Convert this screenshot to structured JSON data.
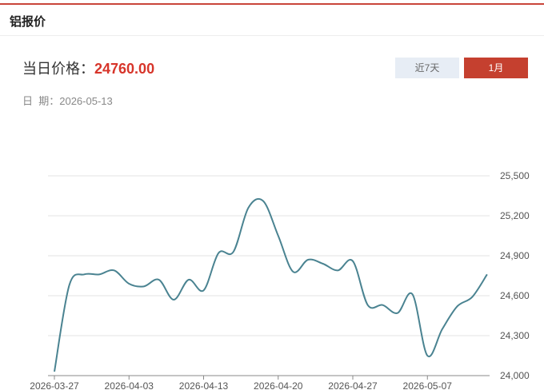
{
  "header": {
    "title": "铝报价"
  },
  "summary": {
    "price_label": "当日价格：",
    "price_value": "24760.00",
    "date_label": "日  期：",
    "date_value": "2026-05-13"
  },
  "range_buttons": [
    {
      "label": "近7天",
      "active": false
    },
    {
      "label": "1月",
      "active": true
    }
  ],
  "colors": {
    "accent": "#c5402f",
    "price": "#d7352a",
    "line": "#4a8391",
    "grid": "#e3e3e3"
  },
  "chart_data": {
    "type": "line",
    "title": "",
    "xlabel": "",
    "ylabel": "",
    "x_ticks": [
      "2026-03-27",
      "2026-04-03",
      "2026-04-13",
      "2026-04-20",
      "2026-04-27",
      "2026-05-07"
    ],
    "y_ticks": [
      24000,
      24300,
      24600,
      24900,
      25200,
      25500
    ],
    "y_tick_labels": [
      "24,000",
      "24,300",
      "24,600",
      "24,900",
      "25,200",
      "25,500"
    ],
    "ylim": [
      24000,
      25500
    ],
    "grid": true,
    "series": [
      {
        "values": [
          24030,
          24680,
          24760,
          24760,
          24790,
          24690,
          24670,
          24720,
          24570,
          24720,
          24640,
          24920,
          24930,
          25260,
          25310,
          25050,
          24780,
          24870,
          24840,
          24790,
          24860,
          24530,
          24530,
          24470,
          24610,
          24150,
          24350,
          24520,
          24590,
          24760
        ]
      }
    ]
  }
}
